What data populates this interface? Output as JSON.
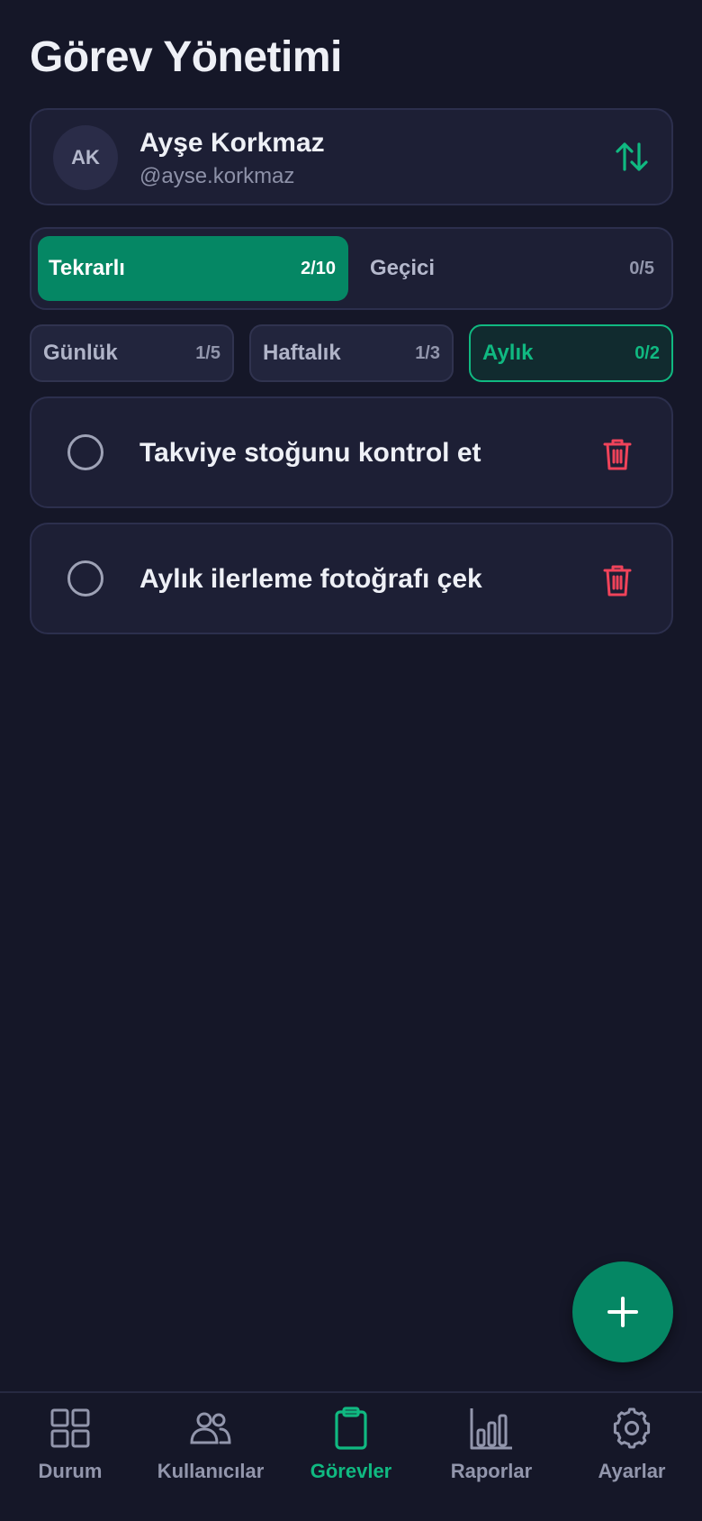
{
  "header": {
    "title": "Görev Yönetimi"
  },
  "user": {
    "initials": "AK",
    "name": "Ayşe Korkmaz",
    "handle": "@ayse.korkmaz",
    "switch_icon": "swap-vertical-icon"
  },
  "mode_tabs": [
    {
      "label": "Tekrarlı",
      "count": "2/10",
      "active": true
    },
    {
      "label": "Geçici",
      "count": "0/5",
      "active": false
    }
  ],
  "period_tabs": [
    {
      "label": "Günlük",
      "count": "1/5",
      "active": false
    },
    {
      "label": "Haftalık",
      "count": "1/3",
      "active": false
    },
    {
      "label": "Aylık",
      "count": "0/2",
      "active": true
    }
  ],
  "tasks": [
    {
      "title": "Takviye stoğunu kontrol et",
      "completed": false,
      "delete_icon": "trash-icon"
    },
    {
      "title": "Aylık ilerleme fotoğrafı çek",
      "completed": false,
      "delete_icon": "trash-icon"
    }
  ],
  "fab": {
    "icon": "plus-icon"
  },
  "bottom_nav": [
    {
      "label": "Durum",
      "icon": "grid-icon",
      "active": false
    },
    {
      "label": "Kullanıcılar",
      "icon": "users-icon",
      "active": false
    },
    {
      "label": "Görevler",
      "icon": "clipboard-icon",
      "active": true
    },
    {
      "label": "Raporlar",
      "icon": "bar-chart-icon",
      "active": false
    },
    {
      "label": "Ayarlar",
      "icon": "gear-icon",
      "active": false
    }
  ],
  "colors": {
    "background": "#151728",
    "card": "#1d1f35",
    "accent": "#10b981",
    "accent_dark": "#058764",
    "danger": "#f0435a",
    "muted": "#9296ac"
  }
}
